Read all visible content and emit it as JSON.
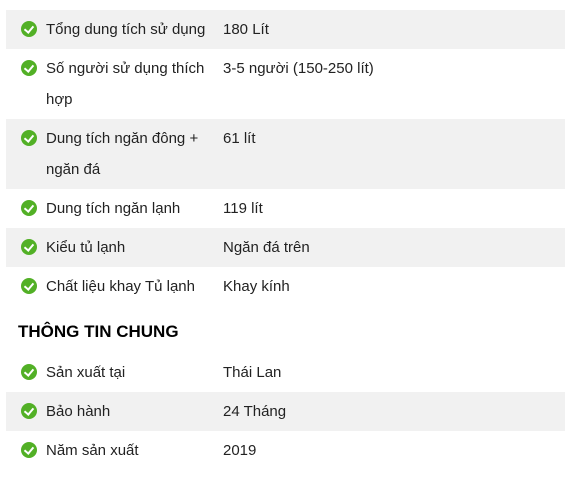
{
  "specs": [
    {
      "label": "Tổng dung tích sử dụng",
      "value": "180 Lít"
    },
    {
      "label": "Số người sử dụng thích hợp",
      "value": "3-5 người (150-250 lít)"
    },
    {
      "label": "Dung tích ngăn đông + ngăn đá",
      "value": "61 lít"
    },
    {
      "label": "Dung tích ngăn lạnh",
      "value": "119 lít"
    },
    {
      "label": "Kiểu tủ lạnh",
      "value": "Ngăn đá trên"
    },
    {
      "label": "Chất liệu khay Tủ lạnh",
      "value": "Khay kính"
    }
  ],
  "general": {
    "heading": "THÔNG TIN CHUNG",
    "items": [
      {
        "label": "Sản xuất tại",
        "value": "Thái Lan"
      },
      {
        "label": "Bảo hành",
        "value": "24 Tháng"
      },
      {
        "label": "Năm sản xuất",
        "value": "2019"
      }
    ]
  },
  "icon": "check-circle-icon",
  "accent": "#52b026"
}
